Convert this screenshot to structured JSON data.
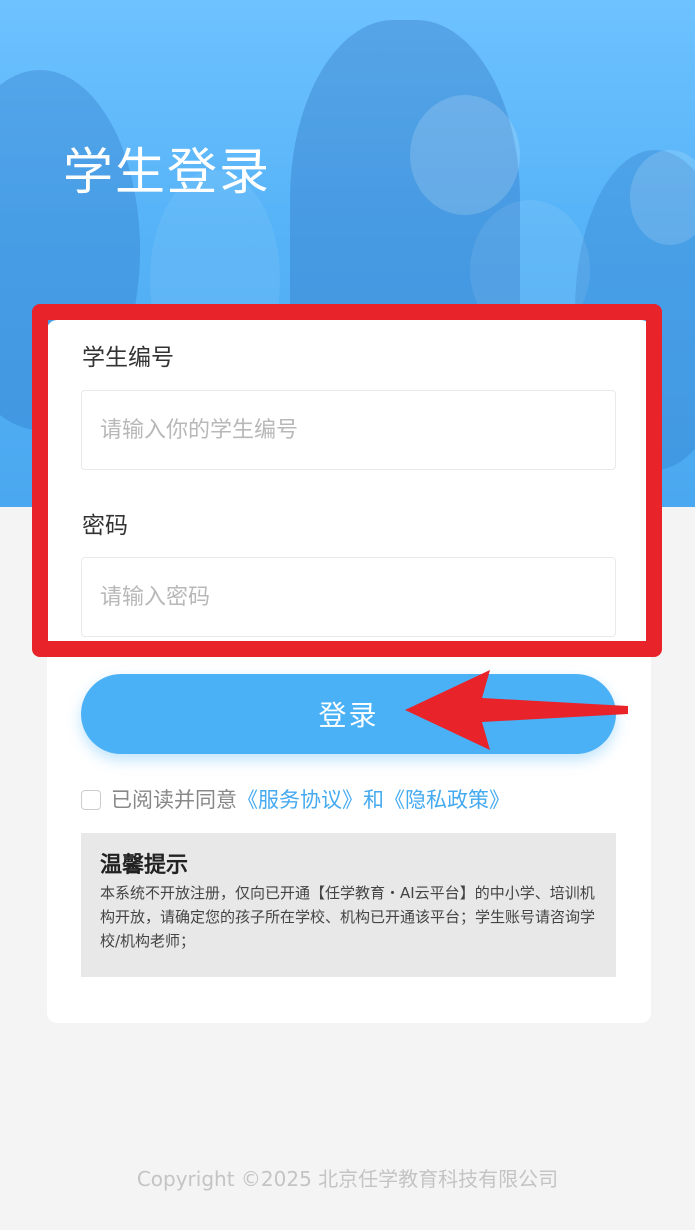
{
  "header": {
    "title": "学生登录"
  },
  "form": {
    "student_id": {
      "label": "学生编号",
      "placeholder": "请输入你的学生编号",
      "value": ""
    },
    "password": {
      "label": "密码",
      "placeholder": "请输入密码",
      "value": ""
    },
    "login_label": "登录"
  },
  "agreement": {
    "checked": false,
    "prefix": "已阅读并同意",
    "service_link": "《服务协议》",
    "conjunction": "和",
    "privacy_link": "《隐私政策》"
  },
  "tips": {
    "title": "温馨提示",
    "body": "本系统不开放注册，仅向已开通【任学教育・AI云平台】的中小学、培训机构开放，请确定您的孩子所在学校、机构已开通该平台；学生账号请咨询学校/机构老师；"
  },
  "footer": {
    "copyright": "Copyright ©2025 北京任学教育科技有限公司"
  },
  "colors": {
    "primary": "#4ab1f7",
    "link": "#45aaf0",
    "highlight_red": "#e8232a",
    "page_bg": "#f4f4f4"
  },
  "icons": {
    "annotation_arrow": "red-arrow-icon"
  }
}
